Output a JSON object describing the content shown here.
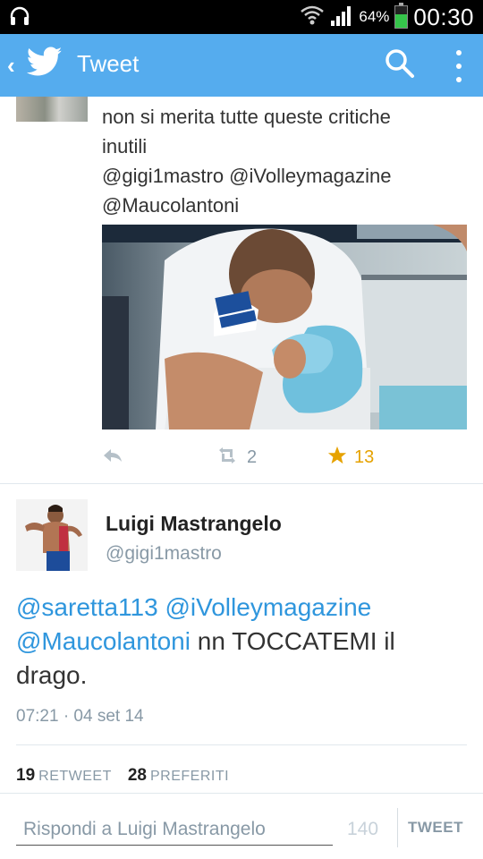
{
  "status_bar": {
    "battery_percent": "64%",
    "battery_level": 0.64,
    "time": "00:30",
    "icons": [
      "headphones-icon",
      "wifi-icon",
      "signal-icon",
      "battery-icon"
    ]
  },
  "action_bar": {
    "title": "Tweet",
    "icons": [
      "back-icon",
      "twitter-bird-icon",
      "search-icon",
      "more-vert-icon"
    ]
  },
  "previous_tweet": {
    "text_line1": "non si merita tutte queste critiche",
    "text_line2": "inutili",
    "text_line3": "@gigi1mastro @iVolleymagazine",
    "text_line4": "@Maucolantoni",
    "retweet_count": "2",
    "favorite_count": "13",
    "colors": {
      "favorite": "#e6a200",
      "inactive": "#8899a6"
    }
  },
  "tweet": {
    "name": "Luigi Mastrangelo",
    "handle": "@gigi1mastro",
    "mention1": "@saretta113",
    "mention2": "@iVolleymagazine",
    "mention3": "@Maucolantoni",
    "text_after": " nn TOCCATEMI il drago.",
    "timestamp": "07:21 · 04 set 14",
    "retweets": "19",
    "retweets_label": "RETWEET",
    "favorites": "28",
    "favorites_label": "PREFERITI"
  },
  "reply": {
    "placeholder": "Rispondi a Luigi Mastrangelo",
    "counter": "140",
    "button_label": "TWEET"
  },
  "colors": {
    "brand": "#55acee",
    "link": "#2f96dd",
    "muted": "#8899a6"
  }
}
